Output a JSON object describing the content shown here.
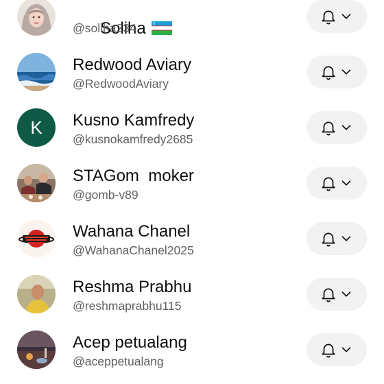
{
  "subscriptions": [
    {
      "name": "Soliha",
      "handle": "@soliha234",
      "flag": "uzbekistan-flag",
      "avatar": "photo-woman-hijab"
    },
    {
      "name": "Redwood Aviary",
      "handle": "@RedwoodAviary",
      "avatar": "photo-ocean"
    },
    {
      "name": "Kusno Kamfredy",
      "handle": "@kusnokamfredy2685",
      "avatar_letter": "K",
      "avatar_color": "#0f5a46"
    },
    {
      "name": "STAGom  moker",
      "handle": "@gomb-v89",
      "avatar": "photo-men-table"
    },
    {
      "name": "Wahana Chanel",
      "handle": "@WahanaChanel2025",
      "avatar": "logo-wahana"
    },
    {
      "name": "Reshma Prabhu",
      "handle": "@reshmaprabhu115",
      "avatar": "photo-woman-yellow"
    },
    {
      "name": "Acep petualang",
      "handle": "@aceppetualang",
      "avatar": "photo-night-scene"
    }
  ],
  "icons": {
    "notification": "bell-icon",
    "dropdown": "chevron-down-icon"
  },
  "colors": {
    "text_primary": "#0f0f0f",
    "text_secondary": "#606060",
    "button_bg": "#f2f2f2",
    "avatar_letter_bg": "#0f5a46"
  }
}
